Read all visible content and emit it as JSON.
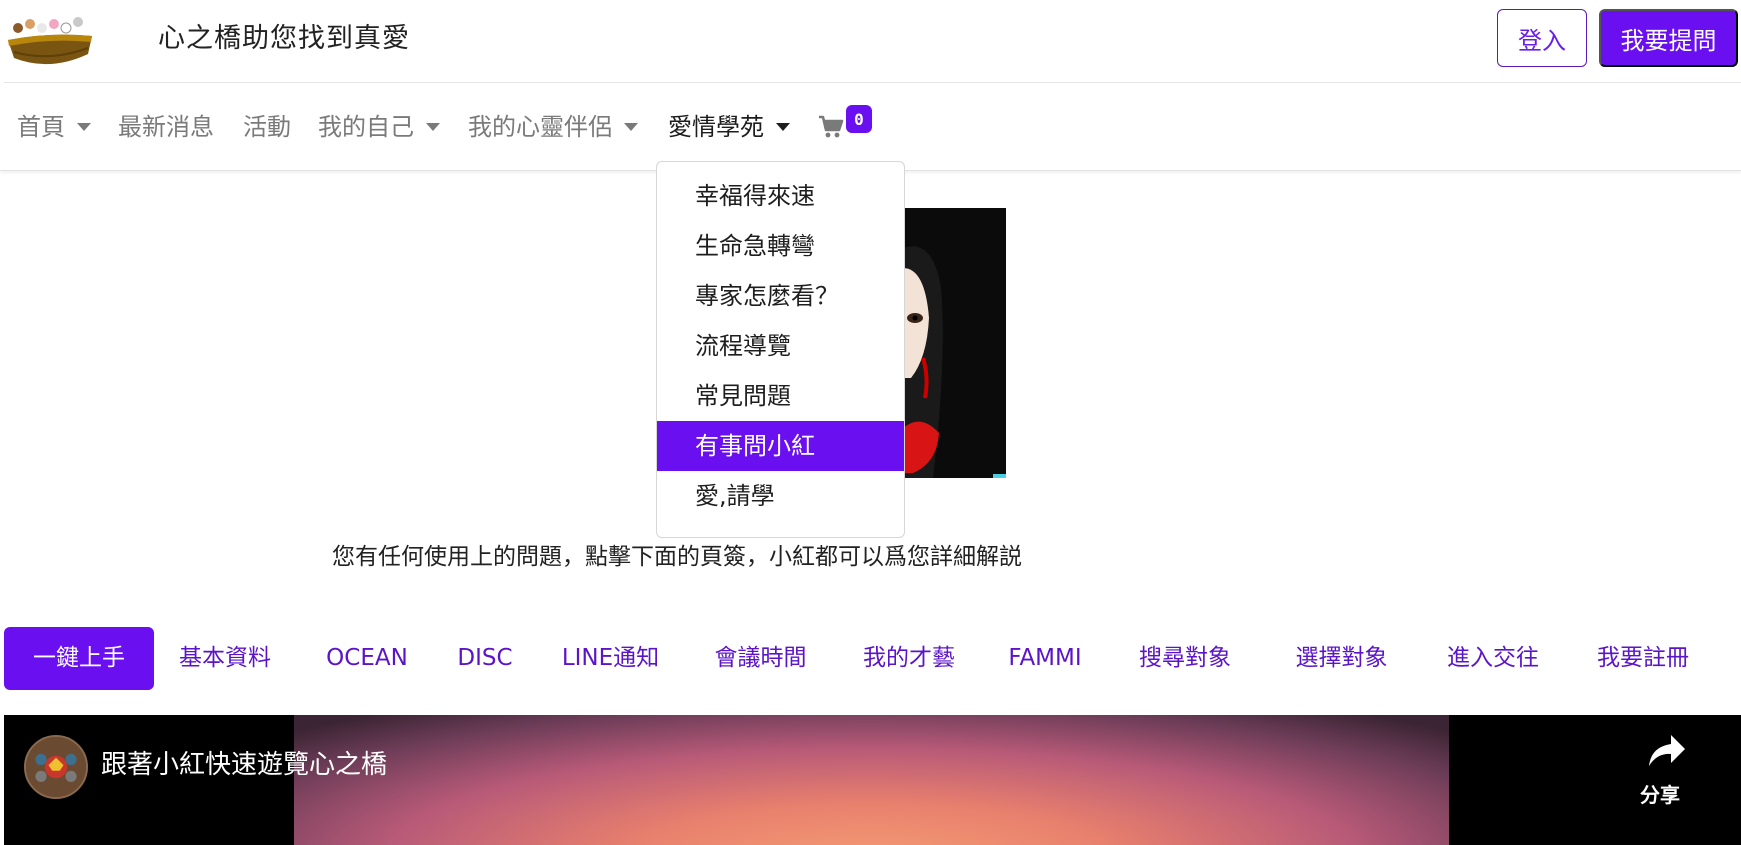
{
  "header": {
    "site_title": "心之橋助您找到真愛",
    "login_label": "登入",
    "ask_label": "我要提問"
  },
  "nav": {
    "items": [
      {
        "label": "首頁",
        "has_caret": true
      },
      {
        "label": "最新消息",
        "has_caret": false
      },
      {
        "label": "活動",
        "has_caret": false
      },
      {
        "label": "我的自己",
        "has_caret": true
      },
      {
        "label": "我的心靈伴侶",
        "has_caret": true
      },
      {
        "label": "愛情學苑",
        "has_caret": true,
        "active": true
      }
    ],
    "cart_icon": "shopping-cart-icon",
    "cart_count": "0"
  },
  "dropdown": {
    "items": [
      {
        "label": "幸福得來速"
      },
      {
        "label": "生命急轉彎"
      },
      {
        "label": "專家怎麼看？"
      },
      {
        "label": "流程導覽"
      },
      {
        "label": "常見問題"
      },
      {
        "label": "有事問小紅",
        "active": true
      },
      {
        "label": "愛,請學"
      }
    ]
  },
  "intro_text": "您有任何使用上的問題，點擊下面的頁簽，小紅都可以爲您詳細解説",
  "tabs": [
    {
      "label": "一鍵上手",
      "active": true
    },
    {
      "label": "基本資料"
    },
    {
      "label": "OCEAN"
    },
    {
      "label": "DISC"
    },
    {
      "label": "LINE通知"
    },
    {
      "label": "會議時間"
    },
    {
      "label": "我的才藝"
    },
    {
      "label": "FAMMI"
    },
    {
      "label": "搜尋對象"
    },
    {
      "label": "選擇對象"
    },
    {
      "label": "進入交往"
    },
    {
      "label": "我要註冊"
    }
  ],
  "video": {
    "title": "跟著小紅快速遊覽心之橋",
    "share_label": "分享",
    "share_icon": "share-arrow-icon"
  },
  "colors": {
    "accent": "#6a0ff0",
    "tab_text": "#5b14c8"
  }
}
